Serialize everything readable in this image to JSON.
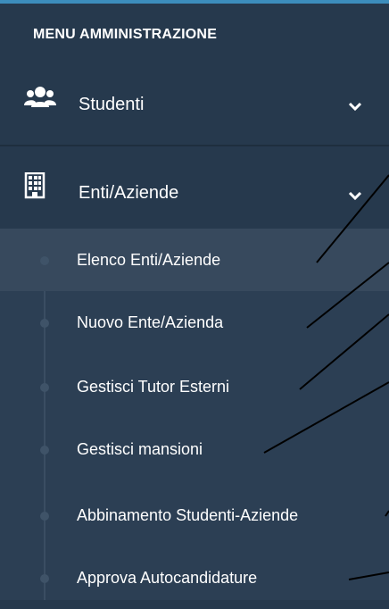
{
  "header": {
    "title": "MENU AMMINISTRAZIONE"
  },
  "menu": {
    "items": [
      {
        "label": "Studenti",
        "icon": "users-icon"
      },
      {
        "label": "Enti/Aziende",
        "icon": "building-icon"
      }
    ]
  },
  "submenu": {
    "items": [
      {
        "label": "Elenco Enti/Aziende"
      },
      {
        "label": "Nuovo Ente/Azienda"
      },
      {
        "label": "Gestisci Tutor Esterni"
      },
      {
        "label": "Gestisci mansioni"
      },
      {
        "label": "Abbinamento Studenti-Aziende"
      },
      {
        "label": "Approva Autocandidature"
      }
    ]
  },
  "colors": {
    "background": "#26394d",
    "submenu_background": "#2c3f54",
    "active_item": "#37495d",
    "accent_strip": "#3c8dbc",
    "text": "#ffffff",
    "annotation_line": "#000000"
  }
}
